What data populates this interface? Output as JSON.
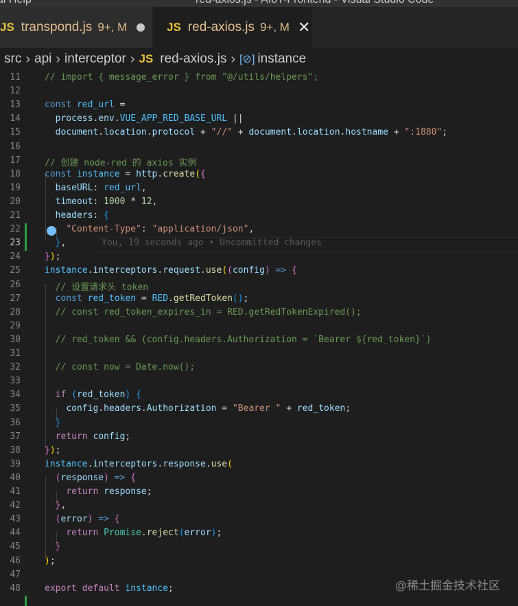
{
  "window": {
    "menu_left": "al   Help",
    "title": "red-axios.js - AIoT-Frontend - Visual Studio Code"
  },
  "tabs": [
    {
      "icon": "JS",
      "label": "transpond.js",
      "badge": "9+, M"
    },
    {
      "icon": "JS",
      "label": "red-axios.js",
      "badge": "9+, M"
    }
  ],
  "breadcrumb": {
    "items": [
      "src",
      "api",
      "interceptor",
      "red-axios.js",
      "instance"
    ],
    "file_icon": "JS"
  },
  "blame": "You, 19 seconds ago • Uncommitted changes",
  "code": {
    "line_numbers": [
      "11",
      "12",
      "13",
      "14",
      "15",
      "16",
      "17",
      "18",
      "19",
      "20",
      "21",
      "22",
      "23",
      "24",
      "25",
      "26",
      "27",
      "28",
      "29",
      "30",
      "31",
      "32",
      "33",
      "34",
      "35",
      "36",
      "37",
      "38",
      "39",
      "40",
      "41",
      "42",
      "43",
      "44",
      "45",
      "46",
      "47",
      "48"
    ],
    "lines": [
      [
        [
          "cmt",
          "// import { message_error } from \"@/utils/helpers\";"
        ]
      ],
      [],
      [
        [
          "kw",
          "const "
        ],
        [
          "cst",
          "red_url"
        ],
        [
          "",
          ""
        ],
        [
          "",
          " ="
        ]
      ],
      [
        [
          "",
          "  "
        ],
        [
          "var",
          "process"
        ],
        [
          "",
          "."
        ],
        [
          "var",
          "env"
        ],
        [
          "",
          "."
        ],
        [
          "cst",
          "VUE_APP_RED_BASE_URL"
        ],
        [
          "",
          " ||"
        ]
      ],
      [
        [
          "",
          "  "
        ],
        [
          "var",
          "document"
        ],
        [
          "",
          "."
        ],
        [
          "var",
          "location"
        ],
        [
          "",
          "."
        ],
        [
          "var",
          "protocol"
        ],
        [
          "",
          " + "
        ],
        [
          "str",
          "\"//\""
        ],
        [
          "",
          " + "
        ],
        [
          "var",
          "document"
        ],
        [
          "",
          "."
        ],
        [
          "var",
          "location"
        ],
        [
          "",
          "."
        ],
        [
          "var",
          "hostname"
        ],
        [
          "",
          " + "
        ],
        [
          "str",
          "\":1880\""
        ],
        [
          "",
          ";"
        ]
      ],
      [],
      [
        [
          "cmt",
          "// 创建 node-red 的 axios 实例"
        ]
      ],
      [
        [
          "kw",
          "const "
        ],
        [
          "cst",
          "instance"
        ],
        [
          "",
          " = "
        ],
        [
          "var",
          "http"
        ],
        [
          "",
          "."
        ],
        [
          "fn",
          "create"
        ],
        [
          "b1",
          "("
        ],
        [
          "b2",
          "{"
        ]
      ],
      [
        [
          "",
          "  "
        ],
        [
          "var",
          "baseURL"
        ],
        [
          "",
          ": "
        ],
        [
          "cst",
          "red_url"
        ],
        [
          "",
          ","
        ]
      ],
      [
        [
          "",
          "  "
        ],
        [
          "var",
          "timeout"
        ],
        [
          "",
          ": "
        ],
        [
          "num",
          "1000"
        ],
        [
          "",
          " * "
        ],
        [
          "num",
          "12"
        ],
        [
          "",
          ","
        ]
      ],
      [
        [
          "",
          "  "
        ],
        [
          "var",
          "headers"
        ],
        [
          "",
          ": "
        ],
        [
          "b3",
          "{"
        ]
      ],
      [
        [
          "",
          "    "
        ],
        [
          "str",
          "\"Content-Type\""
        ],
        [
          "",
          ": "
        ],
        [
          "str",
          "\"application/json\""
        ],
        [
          "",
          ","
        ]
      ],
      [
        [
          "",
          "  "
        ],
        [
          "b3",
          "}"
        ],
        [
          "",
          ","
        ]
      ],
      [
        [
          "b2",
          "}"
        ],
        [
          "b1",
          ")"
        ],
        [
          "",
          ";"
        ]
      ],
      [
        [
          "cst",
          "instance"
        ],
        [
          "",
          "."
        ],
        [
          "var",
          "interceptors"
        ],
        [
          "",
          "."
        ],
        [
          "var",
          "request"
        ],
        [
          "",
          "."
        ],
        [
          "fn",
          "use"
        ],
        [
          "b1",
          "("
        ],
        [
          "b2",
          "("
        ],
        [
          "var",
          "config"
        ],
        [
          "b2",
          ")"
        ],
        [
          "",
          " "
        ],
        [
          "kw",
          "=>"
        ],
        [
          "",
          " "
        ],
        [
          "b2",
          "{"
        ]
      ],
      [
        [
          "",
          "  "
        ],
        [
          "cmt",
          "// 设置请求头 token"
        ]
      ],
      [
        [
          "",
          "  "
        ],
        [
          "kw",
          "const "
        ],
        [
          "cst",
          "red_token"
        ],
        [
          "",
          " = "
        ],
        [
          "cst",
          "RED"
        ],
        [
          "",
          "."
        ],
        [
          "fn",
          "getRedToken"
        ],
        [
          "b3",
          "()"
        ],
        [
          "",
          ";"
        ]
      ],
      [
        [
          "",
          "  "
        ],
        [
          "cmt",
          "// const red_token_expires_in = RED.getRedTokenExpired();"
        ]
      ],
      [],
      [
        [
          "",
          "  "
        ],
        [
          "cmt",
          "// red_token && (config.headers.Authorization = `Bearer ${red_token}`)"
        ]
      ],
      [],
      [
        [
          "",
          "  "
        ],
        [
          "cmt",
          "// const now = Date.now();"
        ]
      ],
      [],
      [
        [
          "",
          "  "
        ],
        [
          "ctl",
          "if "
        ],
        [
          "b3",
          "("
        ],
        [
          "var",
          "red_token"
        ],
        [
          "b3",
          ")"
        ],
        [
          "",
          " "
        ],
        [
          "b3",
          "{"
        ]
      ],
      [
        [
          "",
          "    "
        ],
        [
          "var",
          "config"
        ],
        [
          "",
          "."
        ],
        [
          "var",
          "headers"
        ],
        [
          "",
          "."
        ],
        [
          "var",
          "Authorization"
        ],
        [
          "",
          " = "
        ],
        [
          "str",
          "\"Bearer \""
        ],
        [
          "",
          " + "
        ],
        [
          "var",
          "red_token"
        ],
        [
          "",
          ";"
        ]
      ],
      [
        [
          "",
          "  "
        ],
        [
          "b3",
          "}"
        ]
      ],
      [
        [
          "",
          "  "
        ],
        [
          "ctl",
          "return "
        ],
        [
          "var",
          "config"
        ],
        [
          "",
          ";"
        ]
      ],
      [
        [
          "b2",
          "}"
        ],
        [
          "b1",
          ")"
        ],
        [
          "",
          ";"
        ]
      ],
      [
        [
          "cst",
          "instance"
        ],
        [
          "",
          "."
        ],
        [
          "var",
          "interceptors"
        ],
        [
          "",
          "."
        ],
        [
          "var",
          "response"
        ],
        [
          "",
          "."
        ],
        [
          "fn",
          "use"
        ],
        [
          "b1",
          "("
        ]
      ],
      [
        [
          "",
          "  "
        ],
        [
          "b2",
          "("
        ],
        [
          "var",
          "response"
        ],
        [
          "b2",
          ")"
        ],
        [
          "",
          " "
        ],
        [
          "kw",
          "=>"
        ],
        [
          "",
          " "
        ],
        [
          "b2",
          "{"
        ]
      ],
      [
        [
          "",
          "    "
        ],
        [
          "ctl",
          "return "
        ],
        [
          "var",
          "response"
        ],
        [
          "",
          ";"
        ]
      ],
      [
        [
          "",
          "  "
        ],
        [
          "b2",
          "}"
        ],
        [
          "",
          ","
        ]
      ],
      [
        [
          "",
          "  "
        ],
        [
          "b2",
          "("
        ],
        [
          "var",
          "error"
        ],
        [
          "b2",
          ")"
        ],
        [
          "",
          " "
        ],
        [
          "kw",
          "=>"
        ],
        [
          "",
          " "
        ],
        [
          "b2",
          "{"
        ]
      ],
      [
        [
          "",
          "    "
        ],
        [
          "ctl",
          "return "
        ],
        [
          "cls",
          "Promise"
        ],
        [
          "",
          "."
        ],
        [
          "fn",
          "reject"
        ],
        [
          "b3",
          "("
        ],
        [
          "var",
          "error"
        ],
        [
          "b3",
          ")"
        ],
        [
          "",
          ";"
        ]
      ],
      [
        [
          "",
          "  "
        ],
        [
          "b2",
          "}"
        ]
      ],
      [
        [
          "b1",
          ")"
        ],
        [
          "",
          ";"
        ]
      ],
      [],
      [
        [
          "ctl",
          "export "
        ],
        [
          "ctl",
          "default "
        ],
        [
          "cst",
          "instance"
        ],
        [
          "",
          ";"
        ]
      ]
    ]
  },
  "watermark": "@稀土掘金技术社区"
}
